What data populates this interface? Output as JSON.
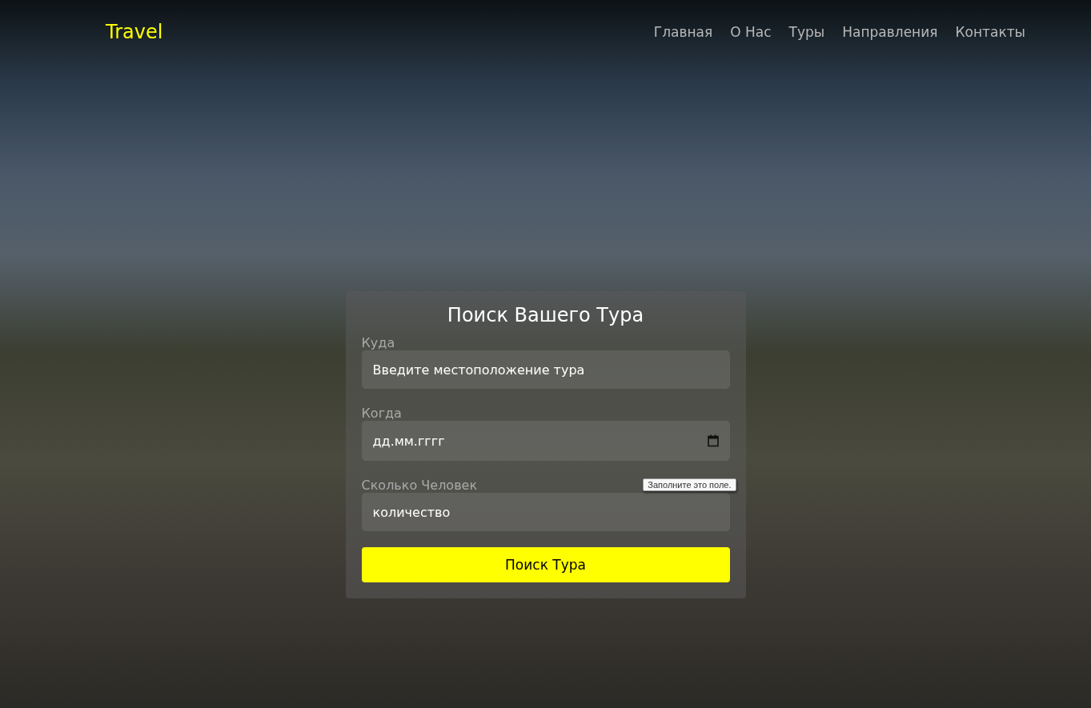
{
  "header": {
    "brand": "Travel",
    "nav": [
      {
        "label": "Главная"
      },
      {
        "label": "О Нас"
      },
      {
        "label": "Туры"
      },
      {
        "label": "Направления"
      },
      {
        "label": "Контакты"
      }
    ]
  },
  "search_form": {
    "title": "Поиск Вашего Тура",
    "fields": [
      {
        "kind": "text",
        "label": "Куда",
        "placeholder": "Введите местоположение тура"
      },
      {
        "kind": "date",
        "label": "Когда",
        "placeholder": "дд.мм.гггг"
      },
      {
        "kind": "number",
        "label": "Сколько Человек",
        "placeholder": "количество",
        "tooltip": "Заполните это поле."
      }
    ],
    "submit": "Поиск Тура"
  }
}
